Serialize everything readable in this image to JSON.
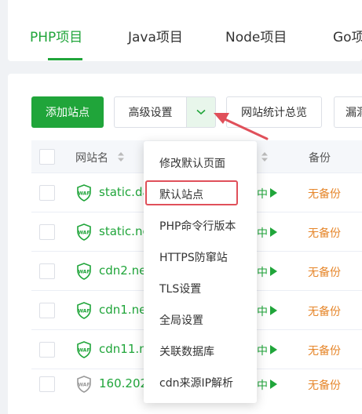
{
  "tabs": [
    {
      "label": "PHP项目",
      "active": true
    },
    {
      "label": "Java项目",
      "active": false
    },
    {
      "label": "Node项目",
      "active": false
    },
    {
      "label": "Go项目",
      "active": false
    }
  ],
  "toolbar": {
    "add_site": "添加站点",
    "advanced": "高级设置",
    "stats": "网站统计总览",
    "vuln": "漏洞"
  },
  "table": {
    "col_site": "网站名",
    "col_backup": "备份"
  },
  "rows": [
    {
      "site": "static.da",
      "status": "中",
      "backup": "无备份"
    },
    {
      "site": "static.ne",
      "status": "中",
      "backup": "无备份"
    },
    {
      "site": "cdn2.ne",
      "status": "中",
      "backup": "无备份"
    },
    {
      "site": "cdn1.ne",
      "status": "中",
      "backup": "无备份"
    },
    {
      "site": "cdn11.n",
      "status": "中",
      "backup": "无备份"
    },
    {
      "site": "160.202",
      "status": "中",
      "backup": "无备份"
    }
  ],
  "dropdown": {
    "items": [
      "修改默认页面",
      "默认站点",
      "PHP命令行版本",
      "HTTPS防窜站",
      "TLS设置",
      "全局设置",
      "关联数据库",
      "cdn来源IP解析"
    ],
    "highlighted_index": 1
  },
  "icons": {
    "waf": "WAF",
    "dropdown_toggle": "chevron-down-icon",
    "sort": "sort-icon",
    "play": "play-icon"
  },
  "colors": {
    "accent": "#20a53a",
    "warning": "#e6862a",
    "highlight": "#e0505a"
  }
}
